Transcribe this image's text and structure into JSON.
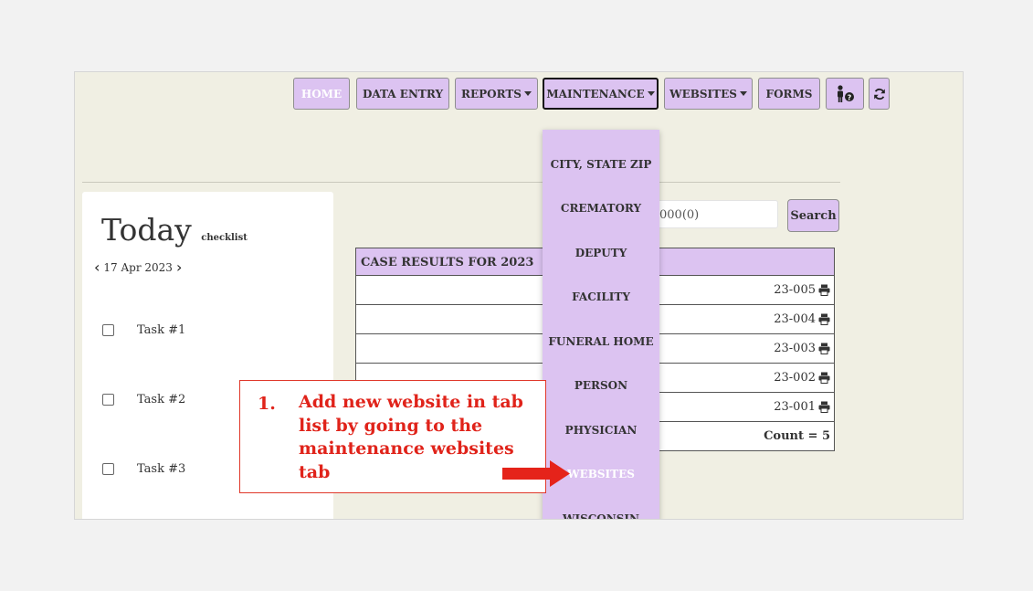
{
  "nav": {
    "home": "HOME",
    "data_entry": "DATA ENTRY",
    "reports": "REPORTS",
    "maintenance": "MAINTENANCE",
    "websites": "WEBSITES",
    "forms": "FORMS",
    "icons": [
      "person-help-icon",
      "refresh-icon"
    ]
  },
  "today": {
    "title": "Today",
    "subtitle": "checklist",
    "date": "17 Apr 2023",
    "tasks": [
      "Task #1",
      "Task #2",
      "Task #3"
    ]
  },
  "search": {
    "placeholder": "000(0)",
    "button": "Search"
  },
  "case_table": {
    "header": "CASE RESULTS FOR 2023",
    "rows": [
      "23-005",
      "23-004",
      "23-003",
      "23-002",
      "23-001"
    ],
    "count": "Count = 5"
  },
  "maintenance_menu": {
    "items": [
      "CITY, STATE ZIP",
      "CREMATORY",
      "DEPUTY",
      "FACILITY",
      "FUNERAL HOME",
      "PERSON",
      "PHYSICIAN",
      "WEBSITES",
      "WISCONSIN"
    ],
    "highlighted": "WEBSITES"
  },
  "callout": {
    "number": "1.",
    "text": "Add new website in tab list by going to the maintenance websites tab"
  },
  "colors": {
    "accent": "#dcc3f1",
    "background": "#f0efe3",
    "annotation": "#e0231a"
  }
}
